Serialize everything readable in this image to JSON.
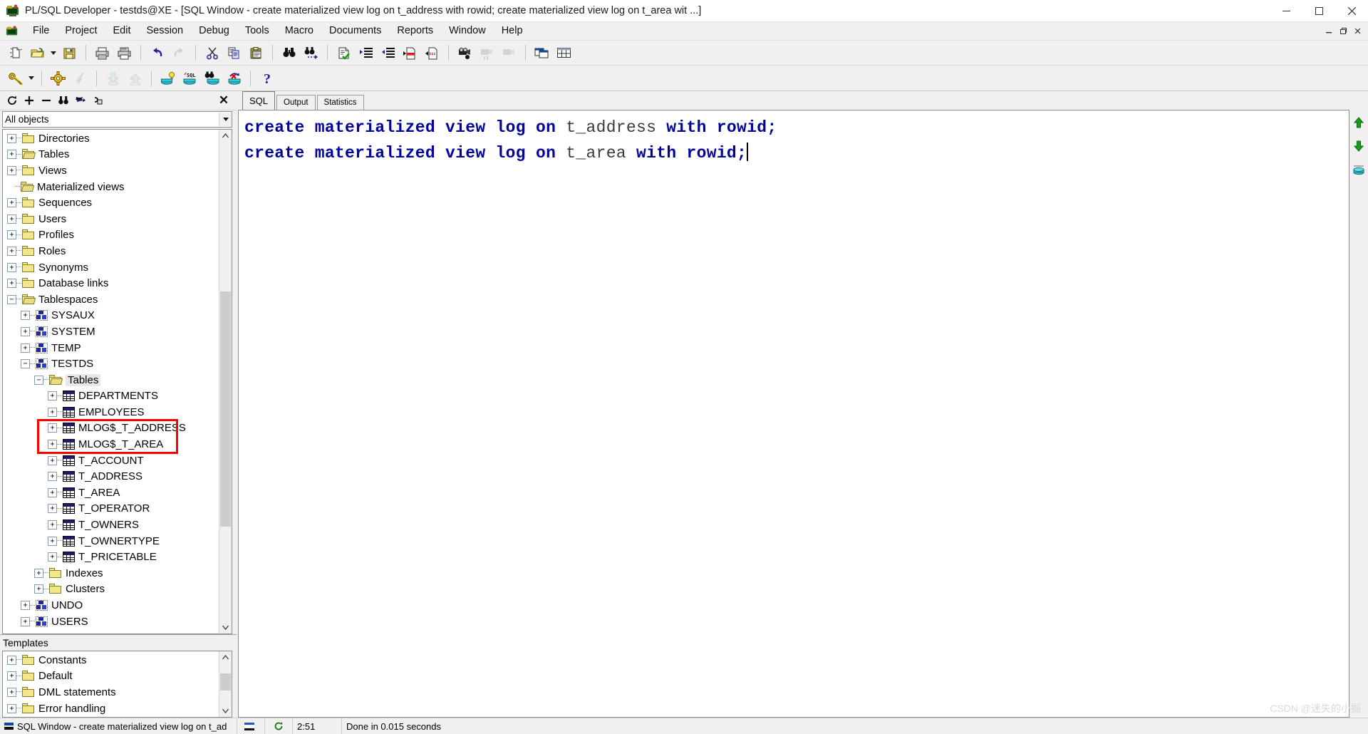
{
  "window": {
    "title": "PL/SQL Developer - testds@XE - [SQL Window - create materialized view log on t_address with rowid; create materialized view log on t_area wit ...]",
    "minimize_label": "–",
    "maximize_label": "❐",
    "close_label": "✕",
    "mdi_minimize": "–",
    "mdi_restore": "❐",
    "mdi_close": "✕"
  },
  "menu": {
    "items": [
      {
        "label": "File"
      },
      {
        "label": "Project"
      },
      {
        "label": "Edit"
      },
      {
        "label": "Session"
      },
      {
        "label": "Debug"
      },
      {
        "label": "Tools"
      },
      {
        "label": "Macro"
      },
      {
        "label": "Documents"
      },
      {
        "label": "Reports"
      },
      {
        "label": "Window"
      },
      {
        "label": "Help"
      }
    ]
  },
  "toolbar_main": {
    "items": [
      {
        "name": "new-icon",
        "tip": "New"
      },
      {
        "name": "open-folder-icon",
        "tip": "Open"
      },
      {
        "name": "open-dropdown-arrow-icon",
        "tip": "Open recent"
      },
      {
        "name": "save-floppy-icon",
        "tip": "Save"
      },
      {
        "name": "print-icon",
        "tip": "Print"
      },
      {
        "name": "print-preview-icon",
        "tip": "Print preview"
      },
      {
        "name": "undo-arrow-icon",
        "tip": "Undo"
      },
      {
        "name": "redo-arrow-icon",
        "tip": "Redo"
      },
      {
        "name": "cut-scissors-icon",
        "tip": "Cut"
      },
      {
        "name": "copy-icon",
        "tip": "Copy"
      },
      {
        "name": "paste-clipboard-icon",
        "tip": "Paste"
      },
      {
        "name": "find-binoculars-icon",
        "tip": "Find"
      },
      {
        "name": "find-next-icon",
        "tip": "Find next"
      },
      {
        "name": "syntax-check-icon",
        "tip": "Syntax check"
      },
      {
        "name": "indent-increase-icon",
        "tip": "Indent"
      },
      {
        "name": "indent-decrease-icon",
        "tip": "Unindent"
      },
      {
        "name": "comment-icon",
        "tip": "Comment"
      },
      {
        "name": "uncomment-icon",
        "tip": "Uncomment"
      },
      {
        "name": "record-macro-icon",
        "tip": "Record macro"
      },
      {
        "name": "play-macro-icon",
        "tip": "Play macro"
      },
      {
        "name": "macro-library-icon",
        "tip": "Macro library"
      },
      {
        "name": "window-list-icon",
        "tip": "Window list"
      },
      {
        "name": "tile-windows-icon",
        "tip": "Tile"
      }
    ]
  },
  "toolbar_second": {
    "items": [
      {
        "name": "login-key-icon",
        "tip": "Log on"
      },
      {
        "name": "login-dropdown-arrow-icon",
        "tip": "Sessions"
      },
      {
        "name": "session-gear-icon",
        "tip": "Session settings"
      },
      {
        "name": "break-session-icon",
        "tip": "Break"
      },
      {
        "name": "commit-icon",
        "tip": "Commit"
      },
      {
        "name": "rollback-icon",
        "tip": "Rollback"
      },
      {
        "name": "explain-plan-icon",
        "tip": "Explain plan"
      },
      {
        "name": "sql-execute-icon",
        "tip": "Execute"
      },
      {
        "name": "find-database-object-icon",
        "tip": "Find database object"
      },
      {
        "name": "recompile-invalid-icon",
        "tip": "Recompile invalid objects"
      },
      {
        "name": "help-question-icon",
        "tip": "Help"
      }
    ]
  },
  "browser": {
    "toolbar": [
      {
        "name": "refresh-icon",
        "glyph": "↻"
      },
      {
        "name": "expand-all-icon",
        "glyph": "＋"
      },
      {
        "name": "collapse-all-icon",
        "glyph": "－"
      },
      {
        "name": "find-object-icon",
        "glyph": "♟"
      },
      {
        "name": "filter-icon",
        "glyph": "⚑"
      },
      {
        "name": "organize-icon",
        "glyph": "⚒"
      }
    ],
    "close_label": "✕",
    "filter_value": "All objects",
    "tree": [
      {
        "label": "Directories",
        "icon": "folder",
        "indent": 0,
        "expander": "+"
      },
      {
        "label": "Tables",
        "icon": "folder-open-small",
        "indent": 0,
        "expander": "+"
      },
      {
        "label": "Views",
        "icon": "folder",
        "indent": 0,
        "expander": "+"
      },
      {
        "label": "Materialized views",
        "icon": "folder-open-small",
        "indent": 0,
        "expander": ""
      },
      {
        "label": "Sequences",
        "icon": "folder",
        "indent": 0,
        "expander": "+"
      },
      {
        "label": "Users",
        "icon": "folder",
        "indent": 0,
        "expander": "+"
      },
      {
        "label": "Profiles",
        "icon": "folder",
        "indent": 0,
        "expander": "+"
      },
      {
        "label": "Roles",
        "icon": "folder",
        "indent": 0,
        "expander": "+"
      },
      {
        "label": "Synonyms",
        "icon": "folder",
        "indent": 0,
        "expander": "+"
      },
      {
        "label": "Database links",
        "icon": "folder",
        "indent": 0,
        "expander": "+"
      },
      {
        "label": "Tablespaces",
        "icon": "folder-open-small",
        "indent": 0,
        "expander": "−"
      },
      {
        "label": "SYSAUX",
        "icon": "tablespace",
        "indent": 1,
        "expander": "+"
      },
      {
        "label": "SYSTEM",
        "icon": "tablespace",
        "indent": 1,
        "expander": "+"
      },
      {
        "label": "TEMP",
        "icon": "tablespace",
        "indent": 1,
        "expander": "+"
      },
      {
        "label": "TESTDS",
        "icon": "tablespace",
        "indent": 1,
        "expander": "−"
      },
      {
        "label": "Tables",
        "icon": "folder-open-small",
        "indent": 2,
        "expander": "−",
        "selected": true
      },
      {
        "label": "DEPARTMENTS",
        "icon": "table",
        "indent": 3,
        "expander": "+"
      },
      {
        "label": "EMPLOYEES",
        "icon": "table",
        "indent": 3,
        "expander": "+"
      },
      {
        "label": "MLOG$_T_ADDRESS",
        "icon": "table",
        "indent": 3,
        "expander": "+",
        "highlighted": true
      },
      {
        "label": "MLOG$_T_AREA",
        "icon": "table",
        "indent": 3,
        "expander": "+",
        "highlighted": true
      },
      {
        "label": "T_ACCOUNT",
        "icon": "table",
        "indent": 3,
        "expander": "+"
      },
      {
        "label": "T_ADDRESS",
        "icon": "table",
        "indent": 3,
        "expander": "+"
      },
      {
        "label": "T_AREA",
        "icon": "table",
        "indent": 3,
        "expander": "+"
      },
      {
        "label": "T_OPERATOR",
        "icon": "table",
        "indent": 3,
        "expander": "+"
      },
      {
        "label": "T_OWNERS",
        "icon": "table",
        "indent": 3,
        "expander": "+"
      },
      {
        "label": "T_OWNERTYPE",
        "icon": "table",
        "indent": 3,
        "expander": "+"
      },
      {
        "label": "T_PRICETABLE",
        "icon": "table",
        "indent": 3,
        "expander": "+"
      },
      {
        "label": "Indexes",
        "icon": "folder",
        "indent": 2,
        "expander": "+"
      },
      {
        "label": "Clusters",
        "icon": "folder",
        "indent": 2,
        "expander": "+"
      },
      {
        "label": "UNDO",
        "icon": "tablespace",
        "indent": 1,
        "expander": "+"
      },
      {
        "label": "USERS",
        "icon": "tablespace",
        "indent": 1,
        "expander": "+"
      }
    ]
  },
  "templates": {
    "header": "Templates",
    "items": [
      {
        "label": "Constants",
        "expander": "+"
      },
      {
        "label": "Default",
        "expander": "+"
      },
      {
        "label": "DML statements",
        "expander": "+"
      },
      {
        "label": "Error handling",
        "expander": "+"
      }
    ],
    "scroll_up": "∧",
    "scroll_down": "∨"
  },
  "editor": {
    "tabs": [
      {
        "label": "SQL",
        "active": true
      },
      {
        "label": "Output",
        "active": false
      },
      {
        "label": "Statistics",
        "active": false
      }
    ],
    "lines": [
      {
        "segments": [
          {
            "text": "create materialized view log on ",
            "kind": "keyword"
          },
          {
            "text": "t_address",
            "kind": "identifier"
          },
          {
            "text": " with rowid;",
            "kind": "keyword"
          }
        ]
      },
      {
        "segments": [
          {
            "text": "create materialized view log on ",
            "kind": "keyword"
          },
          {
            "text": "t_area",
            "kind": "identifier"
          },
          {
            "text": " with rowid;",
            "kind": "keyword"
          }
        ],
        "caret": true
      }
    ],
    "side_buttons": [
      {
        "name": "scroll-to-top-icon",
        "glyph": "⬆"
      },
      {
        "name": "scroll-to-bottom-icon",
        "glyph": "⬇"
      },
      {
        "name": "sql-history-icon",
        "glyph": "☰"
      }
    ]
  },
  "statusbar": {
    "window_label": "SQL Window - create materialized view log on t_ad",
    "cursor_position": "2:51",
    "message": "Done in 0.015 seconds"
  },
  "watermark": "CSDN @迷失的小掘",
  "colors": {
    "keyword": "#00009c",
    "identifier": "#3a3a46",
    "highlight_box": "#ff0000",
    "folder": "#f2e68a",
    "tablespace": "#1e2b8c",
    "titlebar_bg": "#ffffff",
    "chrome_bg": "#f0f0f0"
  }
}
